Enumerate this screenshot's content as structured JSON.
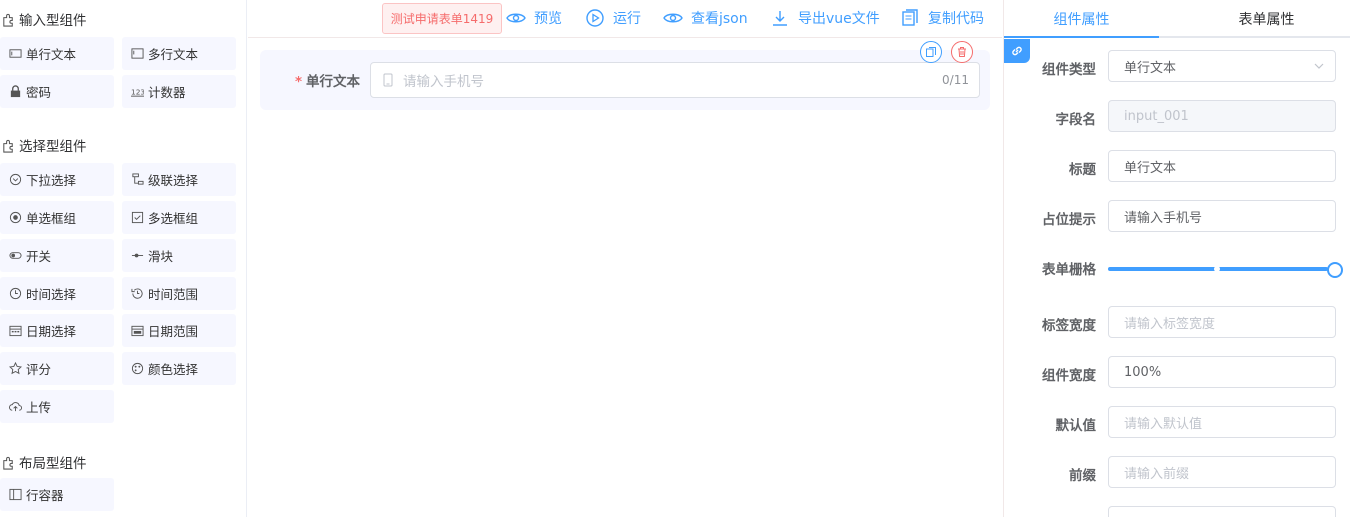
{
  "left": {
    "input_group_title": "输入型组件",
    "input_items": [
      {
        "label": "单行文本",
        "icon": "input-icon"
      },
      {
        "label": "多行文本",
        "icon": "textarea-icon"
      },
      {
        "label": "密码",
        "icon": "lock-icon"
      },
      {
        "label": "计数器",
        "icon": "number-icon"
      }
    ],
    "select_group_title": "选择型组件",
    "select_items": [
      {
        "label": "下拉选择",
        "icon": "select-icon"
      },
      {
        "label": "级联选择",
        "icon": "cascader-icon"
      },
      {
        "label": "单选框组",
        "icon": "radio-icon"
      },
      {
        "label": "多选框组",
        "icon": "checkbox-icon"
      },
      {
        "label": "开关",
        "icon": "switch-icon"
      },
      {
        "label": "滑块",
        "icon": "slider-icon"
      },
      {
        "label": "时间选择",
        "icon": "clock-icon"
      },
      {
        "label": "时间范围",
        "icon": "time-range-icon"
      },
      {
        "label": "日期选择",
        "icon": "calendar-icon"
      },
      {
        "label": "日期范围",
        "icon": "date-range-icon"
      },
      {
        "label": "评分",
        "icon": "star-icon"
      },
      {
        "label": "颜色选择",
        "icon": "palette-icon"
      },
      {
        "label": "上传",
        "icon": "upload-icon"
      }
    ],
    "layout_group_title": "布局型组件",
    "layout_items": [
      {
        "label": "行容器",
        "icon": "row-icon"
      }
    ]
  },
  "toolbar": {
    "form_name": "测试申请表单1419",
    "preview": "预览",
    "run": "运行",
    "view_json": "查看json",
    "export_vue": "导出vue文件",
    "copy_code": "复制代码"
  },
  "canvas": {
    "field_label": "单行文本",
    "required_mark": "*",
    "placeholder": "请输入手机号",
    "counter": "0/11"
  },
  "right": {
    "tab_component": "组件属性",
    "tab_form": "表单属性",
    "props": {
      "type_label": "组件类型",
      "type_value": "单行文本",
      "field_label": "字段名",
      "field_value": "input_001",
      "title_label": "标题",
      "title_value": "单行文本",
      "placeholder_label": "占位提示",
      "placeholder_value": "请输入手机号",
      "span_label": "表单栅格",
      "span_value": 24,
      "span_max": 24,
      "label_width_label": "标签宽度",
      "label_width_placeholder": "请输入标签宽度",
      "comp_width_label": "组件宽度",
      "comp_width_value": "100%",
      "default_label": "默认值",
      "default_placeholder": "请输入默认值",
      "prefix_label": "前缀",
      "prefix_placeholder": "请输入前缀"
    }
  },
  "colors": {
    "primary": "#409eff",
    "danger": "#f56c6c",
    "item_bg": "#f6f7ff"
  }
}
